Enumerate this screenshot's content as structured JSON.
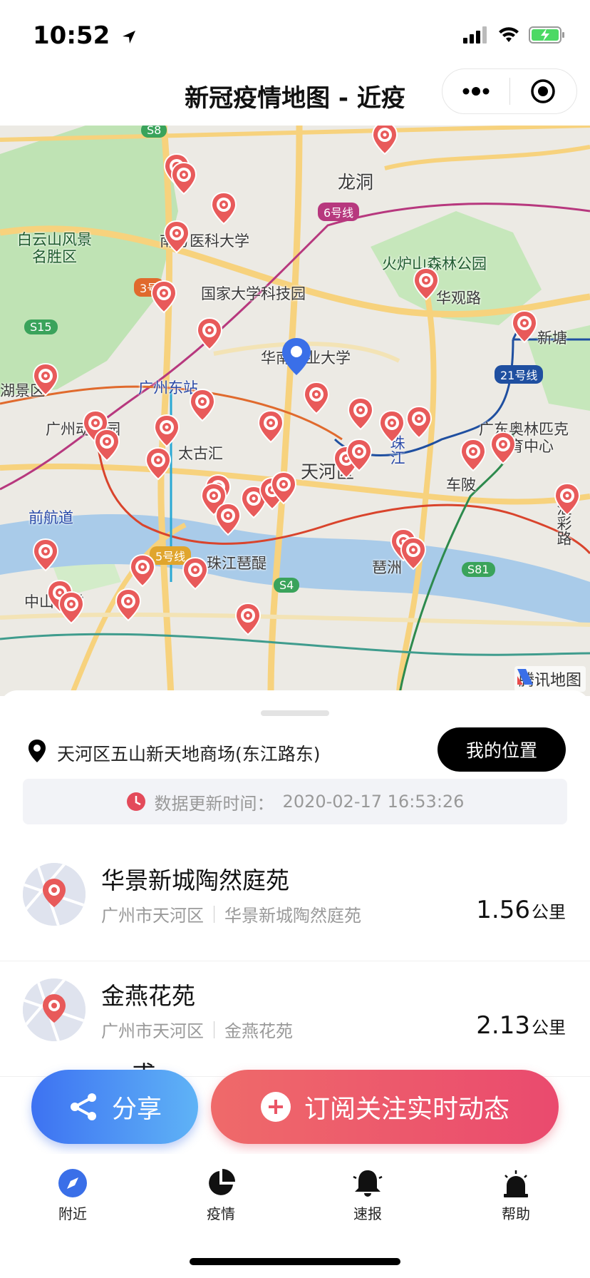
{
  "status_bar": {
    "time": "10:52"
  },
  "nav": {
    "title": "新冠疫情地图 - 近疫"
  },
  "map": {
    "labels": {
      "longdong": "龙洞",
      "baiyunshan": "白云山风景\n名胜区",
      "nanfang": "南方医科大学",
      "huoludshan": "火炉山森林公园",
      "guojia": "国家大学科技园",
      "huaguan": "华观路",
      "xintang": "新塘",
      "huanong": "华南农业大学",
      "gz_east": "广州东站",
      "gz_zoo": "广州动物园",
      "lake": "湖景区",
      "taiguhui": "太古汇",
      "tianhe": "天河区",
      "zhujiang": "珠江",
      "olympic": "广东奥林匹克\n体育中心",
      "chebei": "车陂",
      "qianhang": "前航道",
      "pipa": "珠江琶醍",
      "pizhou": "琶洲",
      "huicai": "汇彩路",
      "zhongshan": "中山大学",
      "tencent": "腾讯地图"
    },
    "badges": {
      "line6": "6号线",
      "line21": "21号线",
      "line3": "3号",
      "line5": "5号线",
      "s15": "S15",
      "s8": "S8",
      "s81": "S81",
      "s4": "S4"
    }
  },
  "location": {
    "address": "天河区五山新天地商场(东江路东)",
    "my_location_label": "我的位置"
  },
  "update": {
    "label": "数据更新时间：",
    "time": "2020-02-17 16:53:26"
  },
  "list": [
    {
      "name": "华景新城陶然庭苑",
      "city": "广州市天河区",
      "place": "华景新城陶然庭苑",
      "distance": "1.56",
      "unit": "公里"
    },
    {
      "name": "金燕花苑",
      "city": "广州市天河区",
      "place": "金燕花苑",
      "distance": "2.13",
      "unit": "公里"
    }
  ],
  "partial_item": "一 甫",
  "buttons": {
    "share": "分享",
    "subscribe": "订阅关注实时动态"
  },
  "tabs": [
    {
      "label": "附近",
      "icon": "compass-icon"
    },
    {
      "label": "疫情",
      "icon": "pie-chart-icon"
    },
    {
      "label": "速报",
      "icon": "bell-icon"
    },
    {
      "label": "帮助",
      "icon": "siren-icon"
    }
  ],
  "colors": {
    "marker": "#e85a5a",
    "subscribe_start": "#ef6a6a",
    "share_start": "#3d72f2",
    "user_pin": "#3a6fe8"
  }
}
